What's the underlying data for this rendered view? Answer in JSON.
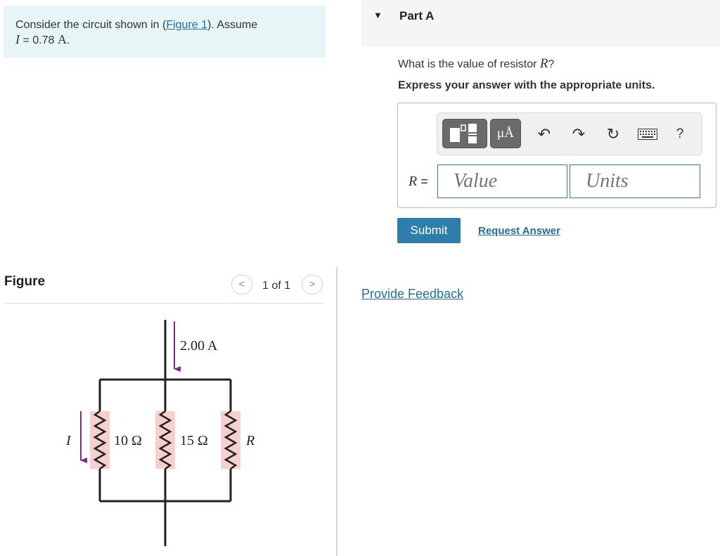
{
  "problem": {
    "prefix": "Consider the circuit shown in (",
    "link": "Figure 1",
    "suffix": "). Assume",
    "var": "I",
    "equals": " = 0.78 ",
    "unit": "A",
    "period": "."
  },
  "figure": {
    "label": "Figure",
    "pager": "1 of 1",
    "prev": "<",
    "next": ">",
    "circuit": {
      "current_in": "2.00 A",
      "r1": "10 Ω",
      "r2": "15 Ω",
      "r3": "R",
      "current_label": "I"
    }
  },
  "part": {
    "caret": "▼",
    "title": "Part A",
    "question_prefix": "What is the value of resistor ",
    "question_var": "R",
    "question_suffix": "?",
    "instruction": "Express your answer with the appropriate units."
  },
  "toolbar": {
    "units_btn": "μÅ",
    "undo": "↶",
    "redo": "↷",
    "reset": "↻",
    "help": "?"
  },
  "answer": {
    "var": "R",
    "equals": " =",
    "value_placeholder": "Value",
    "units_placeholder": "Units"
  },
  "actions": {
    "submit": "Submit",
    "request_answer": "Request Answer",
    "provide_feedback": "Provide Feedback"
  },
  "colors": {
    "accent": "#2e7eab",
    "link": "#1f6d9b",
    "arrow": "#7b2c87",
    "resistor_bg": "#f6cfcf"
  }
}
